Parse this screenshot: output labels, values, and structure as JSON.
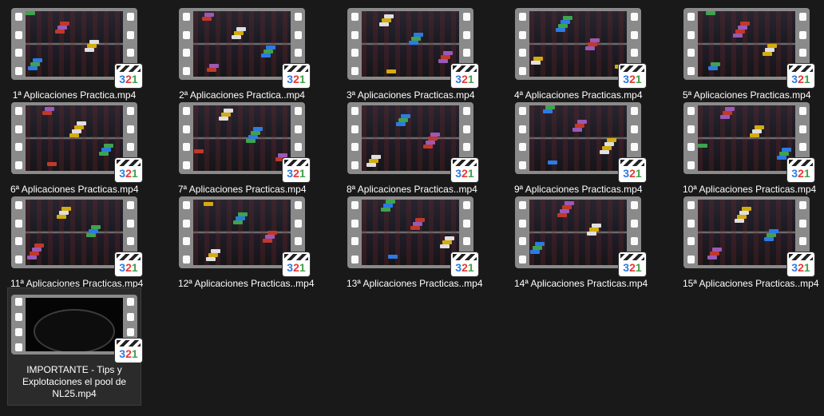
{
  "files": [
    {
      "name": "1ª Aplicaciones Practica.mp4",
      "icon": "video-file-icon"
    },
    {
      "name": "2ª Aplicaciones Practica..mp4",
      "icon": "video-file-icon"
    },
    {
      "name": "3ª Aplicaciones Practicas.mp4",
      "icon": "video-file-icon"
    },
    {
      "name": "4ª Aplicaciones Practicas.mp4",
      "icon": "video-file-icon"
    },
    {
      "name": "5ª Aplicaciones Practicas.mp4",
      "icon": "video-file-icon"
    },
    {
      "name": "6ª Aplicaciones Practicas.mp4",
      "icon": "video-file-icon"
    },
    {
      "name": "7ª Aplicaciones Practicas.mp4",
      "icon": "video-file-icon"
    },
    {
      "name": "8ª Aplicaciones Practicas..mp4",
      "icon": "video-file-icon"
    },
    {
      "name": "9ª Aplicaciones Practicas.mp4",
      "icon": "video-file-icon"
    },
    {
      "name": "10ª Aplicaciones Practicas.mp4",
      "icon": "video-file-icon"
    },
    {
      "name": "11ª Aplicaciones Practicas.mp4",
      "icon": "video-file-icon"
    },
    {
      "name": "12ª Aplicaciones Practicas..mp4",
      "icon": "video-file-icon"
    },
    {
      "name": "13ª Aplicaciones Practicas..mp4",
      "icon": "video-file-icon"
    },
    {
      "name": "14ª Aplicaciones Practicas.mp4",
      "icon": "video-file-icon"
    },
    {
      "name": "15ª Aplicaciones Practicas..mp4",
      "icon": "video-file-icon"
    },
    {
      "name": "IMPORTANTE - Tips y Explotaciones el pool de NL25.mp4",
      "icon": "video-file-icon",
      "selected": true
    }
  ],
  "player_badge": {
    "digits": [
      "3",
      "2",
      "1"
    ],
    "icon": "media-player-badge-icon"
  },
  "colors": {
    "background": "#191919",
    "selected_tile": "#2b2b2b",
    "text": "#ffffff"
  }
}
